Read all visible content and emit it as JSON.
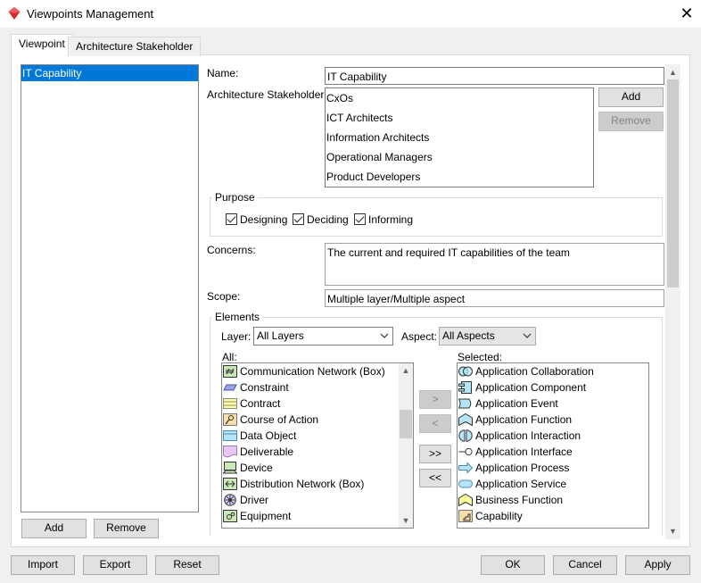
{
  "window": {
    "title": "Viewpoints Management",
    "close_glyph": "✕"
  },
  "tabs": [
    {
      "label": "Viewpoint",
      "active": true
    },
    {
      "label": "Architecture Stakeholder",
      "active": false
    }
  ],
  "viewpoint_list": {
    "items": [
      "IT Capability"
    ],
    "selected_index": 0,
    "add_label": "Add",
    "remove_label": "Remove"
  },
  "form": {
    "name_label": "Name:",
    "name_value": "IT Capability",
    "stakeholders_label": "Architecture Stakeholders:",
    "stakeholders": [
      "CxOs",
      "ICT Architects",
      "Information Architects",
      "Operational Managers",
      "Product Developers"
    ],
    "stakeholder_add_label": "Add",
    "stakeholder_remove_label": "Remove",
    "purpose": {
      "title": "Purpose",
      "options": [
        {
          "label": "Designing",
          "checked": true
        },
        {
          "label": "Deciding",
          "checked": true
        },
        {
          "label": "Informing",
          "checked": true
        }
      ]
    },
    "concerns_label": "Concerns:",
    "concerns_value": "The current and required IT capabilities of the team",
    "scope_label": "Scope:",
    "scope_value": "Multiple layer/Multiple aspect"
  },
  "elements": {
    "title": "Elements",
    "layer_label": "Layer:",
    "layer_value": "All Layers",
    "aspect_label": "Aspect:",
    "aspect_value": "All Aspects",
    "all_label": "All:",
    "selected_label": "Selected:",
    "all_items": [
      {
        "label": "Communication Network (Box)",
        "icon": "communication-network-icon"
      },
      {
        "label": "Constraint",
        "icon": "constraint-icon"
      },
      {
        "label": "Contract",
        "icon": "contract-icon"
      },
      {
        "label": "Course of Action",
        "icon": "course-of-action-icon"
      },
      {
        "label": "Data Object",
        "icon": "data-object-icon"
      },
      {
        "label": "Deliverable",
        "icon": "deliverable-icon"
      },
      {
        "label": "Device",
        "icon": "device-icon"
      },
      {
        "label": "Distribution Network (Box)",
        "icon": "distribution-network-icon"
      },
      {
        "label": "Driver",
        "icon": "driver-icon"
      },
      {
        "label": "Equipment",
        "icon": "equipment-icon"
      }
    ],
    "selected_items": [
      {
        "label": "Application Collaboration",
        "icon": "application-collaboration-icon"
      },
      {
        "label": "Application Component",
        "icon": "application-component-icon"
      },
      {
        "label": "Application Event",
        "icon": "application-event-icon"
      },
      {
        "label": "Application Function",
        "icon": "application-function-icon"
      },
      {
        "label": "Application Interaction",
        "icon": "application-interaction-icon"
      },
      {
        "label": "Application Interface",
        "icon": "application-interface-icon"
      },
      {
        "label": "Application Process",
        "icon": "application-process-icon"
      },
      {
        "label": "Application Service",
        "icon": "application-service-icon"
      },
      {
        "label": "Business Function",
        "icon": "business-function-icon"
      },
      {
        "label": "Capability",
        "icon": "capability-icon"
      }
    ],
    "move_buttons": {
      "add_one": ">",
      "remove_one": "<",
      "add_all": ">>",
      "remove_all": "<<"
    }
  },
  "footer": {
    "import_label": "Import",
    "export_label": "Export",
    "reset_label": "Reset",
    "ok_label": "OK",
    "cancel_label": "Cancel",
    "apply_label": "Apply"
  },
  "colors": {
    "selection": "#0078d7",
    "app_icon": "#d9272e",
    "application_layer": "#b5e4f7",
    "business_layer": "#ffff9e",
    "technology_layer": "#c9e7b7"
  }
}
